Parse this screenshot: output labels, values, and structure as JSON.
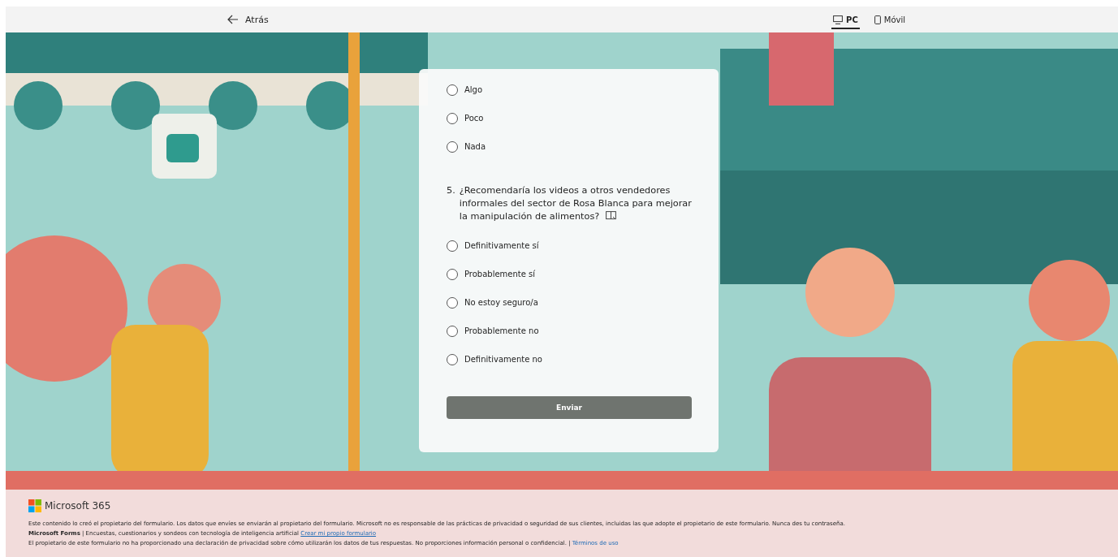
{
  "top_bar": {
    "back": "Atrás",
    "view_tabs": [
      {
        "label": "PC",
        "kind": "monitor",
        "selected": true
      },
      {
        "label": "Móvil",
        "kind": "phone",
        "selected": false
      }
    ]
  },
  "form": {
    "previous_options": [
      {
        "label": "Algo",
        "selected": false
      },
      {
        "label": "Poco",
        "selected": false
      },
      {
        "label": "Nada",
        "selected": false
      }
    ],
    "question": {
      "number": "5.",
      "text": "¿Recomendaría los videos a otros vendedores informales del sector de Rosa Blanca para mejorar la manipulación de alimentos?",
      "options": [
        {
          "label": "Definitivamente sí",
          "selected": false
        },
        {
          "label": "Probablemente sí",
          "selected": false
        },
        {
          "label": "No estoy seguro/a",
          "selected": false
        },
        {
          "label": "Probablemente no",
          "selected": false
        },
        {
          "label": "Definitivamente no",
          "selected": false
        }
      ]
    },
    "submit": "Enviar"
  },
  "footer": {
    "brand": "Microsoft 365",
    "notice": "Este contenido lo creó el propietario del formulario. Los datos que envíes se enviarán al propietario del formulario. Microsoft no es responsable de las prácticas de privacidad o seguridad de sus clientes, incluidas las que adopte el propietario de este formulario. Nunca des tu contraseña.",
    "forms_line": "**Microsoft Forms** | Encuestas, cuestionarios y sondeos con tecnología de inteligencia artificial",
    "forms_link": "Crear mi propio formulario",
    "privacy_line": "El propietario de este formulario no ha proporcionado una declaración de privacidad sobre cómo utilizarán los datos de tus respuestas. No proporciones información personal o confidencial. |",
    "terms_link": "Términos de uso"
  }
}
